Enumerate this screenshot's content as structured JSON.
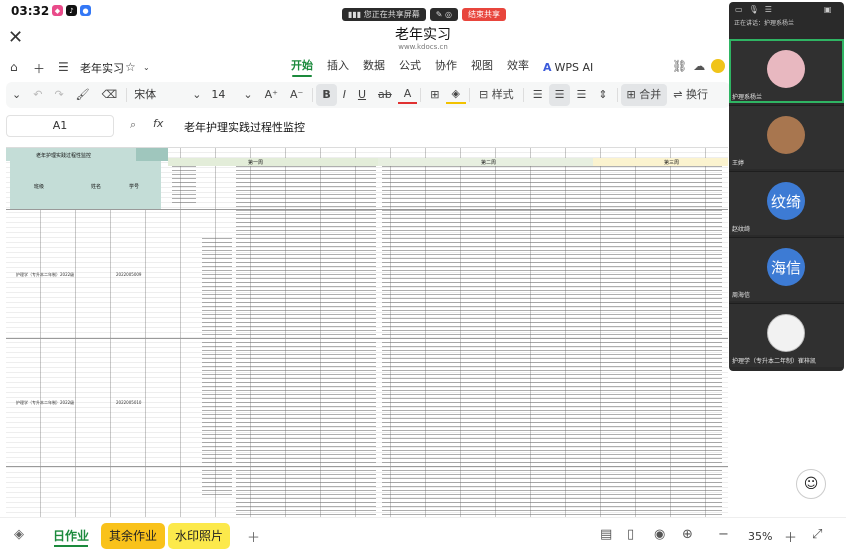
{
  "status": {
    "time": "03:32",
    "share_text": "您正在共享屏幕",
    "end_share_label": "结束共享"
  },
  "document": {
    "title": "老年实习",
    "url": "www.kdocs.cn",
    "file_name": "老年实习"
  },
  "menu": {
    "tabs": [
      "开始",
      "插入",
      "数据",
      "公式",
      "协作",
      "视图",
      "效率",
      "WPS AI"
    ],
    "active_tab": "开始"
  },
  "toolbar": {
    "font_name": "宋体",
    "font_size": "14",
    "bold": "B",
    "italic": "I",
    "underline": "U",
    "style_label": "样式",
    "merge_label": "合并",
    "wrap_label": "换行"
  },
  "formula_bar": {
    "cell_ref": "A1",
    "fx": "fx",
    "content": "老年护理实践过程性监控"
  },
  "sheet": {
    "title_cell": "老年护理实践过程性监控",
    "col_headers": [
      "班级",
      "姓名",
      "学号"
    ],
    "week_labels": [
      "第一周",
      "第二周",
      "第三周"
    ],
    "rows": [
      {
        "class": "护理学（专升本二年制）2022级",
        "id": "2022005009"
      },
      {
        "class": "护理学（专升本二年制）2022级",
        "id": "2022005010"
      }
    ]
  },
  "sheet_tabs": [
    {
      "label": "日作业",
      "color": "#ffffff"
    },
    {
      "label": "其余作业",
      "color": "#f9c21b"
    },
    {
      "label": "水印照片",
      "color": "#fce94b"
    }
  ],
  "zoom": "35%",
  "meeting": {
    "speaking": "正在讲话：护理系杨兰",
    "participants": [
      {
        "name": "护理系杨兰",
        "avatar": "photo",
        "color": "#e8b8c0"
      },
      {
        "name": "王婷",
        "avatar": "photo",
        "color": "#a8764f"
      },
      {
        "name": "赵纹绮",
        "avatar": "纹绮",
        "color": "#3d7bd4"
      },
      {
        "name": "周海信",
        "avatar": "海信",
        "color": "#3d7bd4"
      },
      {
        "name": "护理学（专升本二年制）崔梓凯",
        "avatar": "photo",
        "color": "#f2f2f2"
      }
    ]
  }
}
